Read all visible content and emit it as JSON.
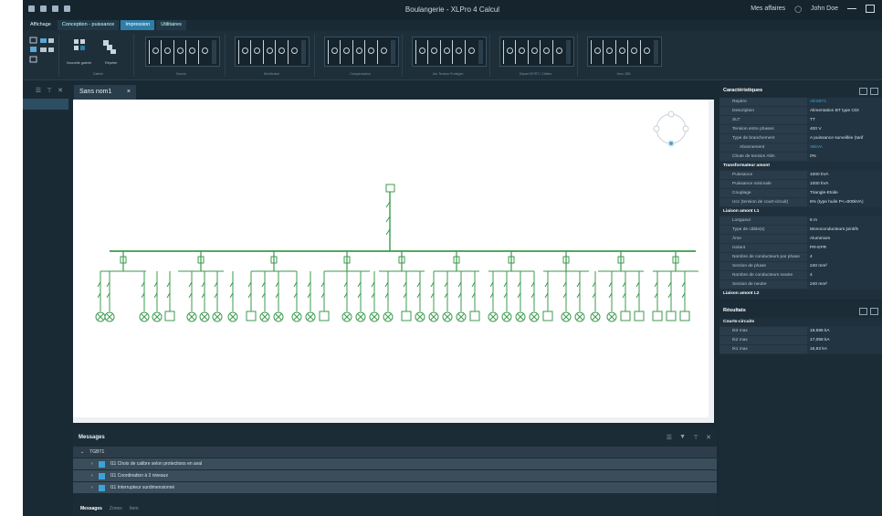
{
  "window": {
    "title": "Boulangerie - XLPro 4 Calcul",
    "affairs": "Mes affaires",
    "user": "John Doe"
  },
  "ribbon": {
    "tabs": [
      {
        "label": "Affichage",
        "active": false
      },
      {
        "label": "Conception - puissance",
        "active": false
      },
      {
        "label": "Impression",
        "active": true
      },
      {
        "label": "Utilitaires",
        "active": false
      }
    ],
    "groups": {
      "gallery_label": "Galerie",
      "new_gallery": "Nouvelle galerie",
      "repeat": "Répéter",
      "source": "Source",
      "distribution": "Distribution",
      "compensation": "Compensation",
      "low_voltage": "Jeu Tension Protégée",
      "departures": "Départ BT/RT / Câbles",
      "bus": "Jeux JDB"
    }
  },
  "document": {
    "tab_label": "Sans nom1",
    "close": "×"
  },
  "messages": {
    "title": "Messages",
    "group": "TGBT1",
    "rows": [
      "I11 Choix de calibre selon protections en aval",
      "I11 Coordination à 3 niveaux",
      "I11 Interrupteur surdimensionné"
    ],
    "tabs": [
      "Messages",
      "Zones",
      "Item"
    ]
  },
  "properties": {
    "title": "Caractéristiques",
    "rows": [
      {
        "k": "Repère",
        "v": "AlimBT1",
        "type": "link"
      },
      {
        "k": "Description",
        "v": "Alimentation BT type CDI"
      },
      {
        "k": "SLT",
        "v": "TT"
      },
      {
        "k": "Tension entre phases",
        "v": "400 V"
      },
      {
        "k": "Type de branchement",
        "v": "A puissance surveillée (tarif",
        "type": "expand"
      },
      {
        "k": "Abonnement",
        "v": "36kVA",
        "type": "link2"
      },
      {
        "k": "Chute de tension Alim",
        "v": "0%",
        "type": "flat"
      },
      {
        "k": "Transformateur amont",
        "type": "section"
      },
      {
        "k": "Puissance",
        "v": "1000 kVA"
      },
      {
        "k": "Puissance minimale",
        "v": "1000 kVA"
      },
      {
        "k": "Couplage",
        "v": "Triangle-Etoile"
      },
      {
        "k": "Ucc (tension de court-circuit)",
        "v": "6% (type huile P<=800kVA)"
      },
      {
        "k": "Liaison amont L1",
        "type": "section"
      },
      {
        "k": "Longueur",
        "v": "6 m"
      },
      {
        "k": "Type de câble(s)",
        "v": "Monoconducteurs jointifs"
      },
      {
        "k": "Âme",
        "v": "Aluminium"
      },
      {
        "k": "Isolant",
        "v": "PR-EPR"
      },
      {
        "k": "Nombre de conducteurs par phase",
        "v": "4"
      },
      {
        "k": "Section de phase",
        "v": "240 mm²"
      },
      {
        "k": "Nombre de conducteurs neutre",
        "v": "4"
      },
      {
        "k": "Section de neutre",
        "v": "240 mm²"
      },
      {
        "k": "Liaison amont L2",
        "type": "section"
      }
    ],
    "results_title": "Résultats",
    "results": [
      {
        "k": "Courts-circuits",
        "type": "section"
      },
      {
        "k": "Ik3 max",
        "v": "19,696 kA"
      },
      {
        "k": "Ik2 max",
        "v": "17,058 kA"
      },
      {
        "k": "Ik1 max",
        "v": "16,93 kA"
      }
    ]
  },
  "colors": {
    "accent": "#2e7ea8",
    "schema_green": "#3c9a4e",
    "link": "#3ba3d9"
  }
}
